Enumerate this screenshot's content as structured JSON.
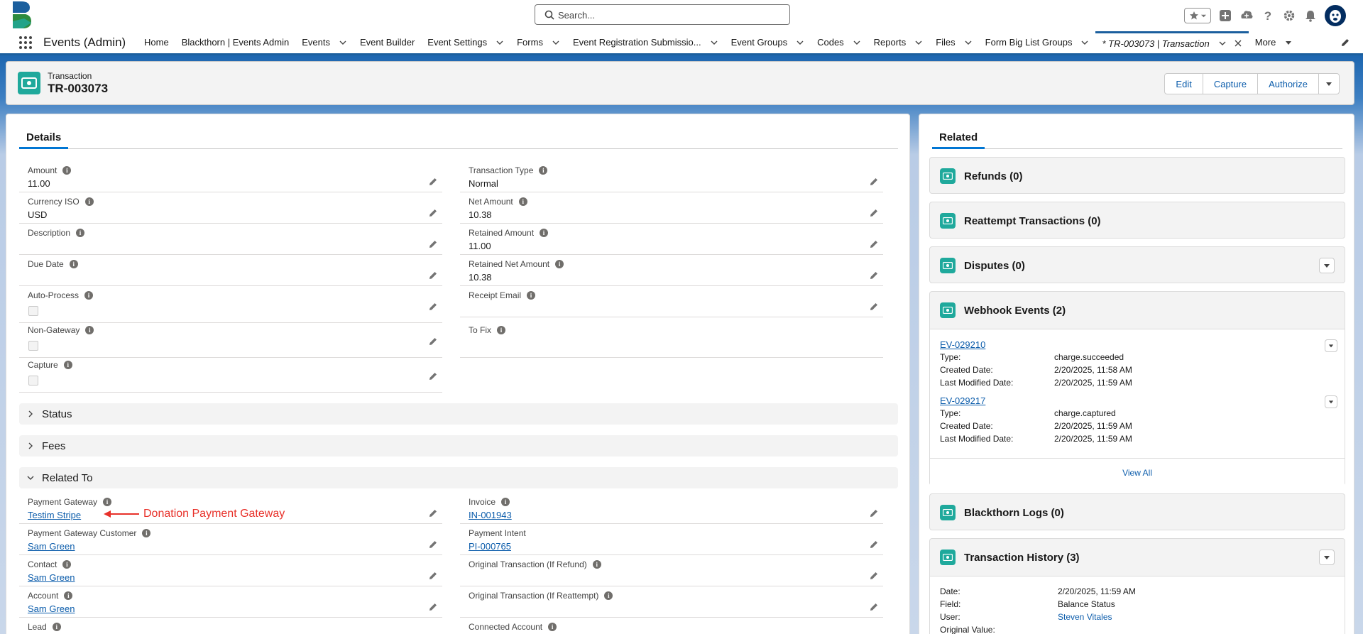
{
  "header": {
    "search_placeholder": "Search..."
  },
  "nav": {
    "app_name": "Events (Admin)",
    "items": [
      {
        "label": "Home",
        "has_menu": false
      },
      {
        "label": "Blackthorn | Events Admin",
        "has_menu": false
      },
      {
        "label": "Events",
        "has_menu": true
      },
      {
        "label": "Event Builder",
        "has_menu": false
      },
      {
        "label": "Event Settings",
        "has_menu": true
      },
      {
        "label": "Forms",
        "has_menu": true
      },
      {
        "label": "Event Registration Submissio...",
        "has_menu": true
      },
      {
        "label": "Event Groups",
        "has_menu": true
      },
      {
        "label": "Codes",
        "has_menu": true
      },
      {
        "label": "Reports",
        "has_menu": true
      },
      {
        "label": "Files",
        "has_menu": true
      },
      {
        "label": "Form Big List Groups",
        "has_menu": true
      }
    ],
    "active_tab": "* TR-003073 | Transaction",
    "more_label": "More"
  },
  "record": {
    "object_label": "Transaction",
    "name": "TR-003073",
    "buttons": [
      "Edit",
      "Capture",
      "Authorize"
    ]
  },
  "details": {
    "tab_label": "Details",
    "left_fields": [
      {
        "label": "Amount",
        "value": "11.00"
      },
      {
        "label": "Currency ISO",
        "value": "USD"
      },
      {
        "label": "Description",
        "value": ""
      },
      {
        "label": "Due Date",
        "value": ""
      },
      {
        "label": "Auto-Process",
        "checked": false
      },
      {
        "label": "Non-Gateway",
        "checked": false
      },
      {
        "label": "Capture",
        "checked": false
      }
    ],
    "right_fields": [
      {
        "label": "Transaction Type",
        "value": "Normal"
      },
      {
        "label": "Net Amount",
        "value": "10.38"
      },
      {
        "label": "Retained Amount",
        "value": "11.00"
      },
      {
        "label": "Retained Net Amount",
        "value": "10.38"
      },
      {
        "label": "Receipt Email",
        "value": ""
      },
      {
        "label": "To Fix",
        "value": ""
      }
    ],
    "sections": {
      "status": "Status",
      "fees": "Fees",
      "related_to": "Related To"
    },
    "related_left": [
      {
        "label": "Payment Gateway",
        "value": "Testim Stripe"
      },
      {
        "label": "Payment Gateway Customer",
        "value": "Sam Green"
      },
      {
        "label": "Contact",
        "value": "Sam Green"
      },
      {
        "label": "Account",
        "value": "Sam Green"
      },
      {
        "label": "Lead",
        "value": ""
      }
    ],
    "related_right": [
      {
        "label": "Invoice",
        "value": "IN-001943"
      },
      {
        "label": "Payment Intent",
        "value": "PI-000765"
      },
      {
        "label": "Original Transaction (If Refund)",
        "value": ""
      },
      {
        "label": "Original Transaction (If Reattempt)",
        "value": ""
      },
      {
        "label": "Connected Account",
        "value": ""
      }
    ],
    "annotation": "Donation Payment Gateway"
  },
  "related": {
    "tab_label": "Related",
    "cards": {
      "refunds": "Refunds (0)",
      "reattempts": "Reattempt Transactions (0)",
      "disputes": "Disputes (0)",
      "webhooks": "Webhook Events (2)",
      "logs": "Blackthorn Logs (0)",
      "history": "Transaction History (3)"
    },
    "webhook_events": [
      {
        "id": "EV-029210",
        "type_label": "Type:",
        "type": "charge.succeeded",
        "created_label": "Created Date:",
        "created": "2/20/2025, 11:58 AM",
        "modified_label": "Last Modified Date:",
        "modified": "2/20/2025, 11:59 AM"
      },
      {
        "id": "EV-029217",
        "type_label": "Type:",
        "type": "charge.captured",
        "created_label": "Created Date:",
        "created": "2/20/2025, 11:59 AM",
        "modified_label": "Last Modified Date:",
        "modified": "2/20/2025, 11:59 AM"
      }
    ],
    "view_all": "View All",
    "history": {
      "date_label": "Date:",
      "date": "2/20/2025, 11:59 AM",
      "field_label": "Field:",
      "field": "Balance Status",
      "user_label": "User:",
      "user": "Steven Vitales",
      "original_label": "Original Value:",
      "original": ""
    }
  },
  "colors": {
    "brand": "#0176d3",
    "link": "#0b5cab",
    "object_icon": "#1fa99c",
    "annotation": "#e8312a"
  }
}
